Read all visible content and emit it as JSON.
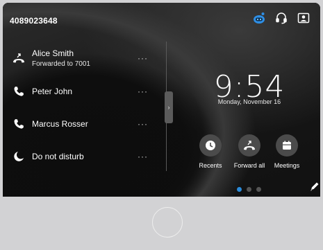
{
  "header": {
    "line_number": "4089023648",
    "icons": [
      "webex-assistant-icon",
      "headset-icon",
      "self-view-icon"
    ]
  },
  "contacts": [
    {
      "name": "Alice Smith",
      "sub": "Forwarded to 7001",
      "icon": "call-forward-icon",
      "more": "···"
    },
    {
      "name": "Peter John",
      "sub": "",
      "icon": "phone-icon",
      "more": "···"
    },
    {
      "name": "Marcus Rosser",
      "sub": "",
      "icon": "phone-icon",
      "more": "···"
    },
    {
      "name": "Do not disturb",
      "sub": "",
      "icon": "moon-icon",
      "more": "···"
    }
  ],
  "handle_glyph": "›",
  "clock": {
    "time": "9:54",
    "date": "Monday, November 16"
  },
  "quick_actions": [
    {
      "label": "Recents",
      "icon": "clock-icon"
    },
    {
      "label": "Forward all",
      "icon": "call-forward-icon"
    },
    {
      "label": "Meetings",
      "icon": "calendar-icon"
    }
  ],
  "pager": {
    "pages": 3,
    "active": 1
  },
  "colors": {
    "accent": "#2b8bd9",
    "screen": "#1b1b1b",
    "bezel": "#d2d2d4"
  }
}
